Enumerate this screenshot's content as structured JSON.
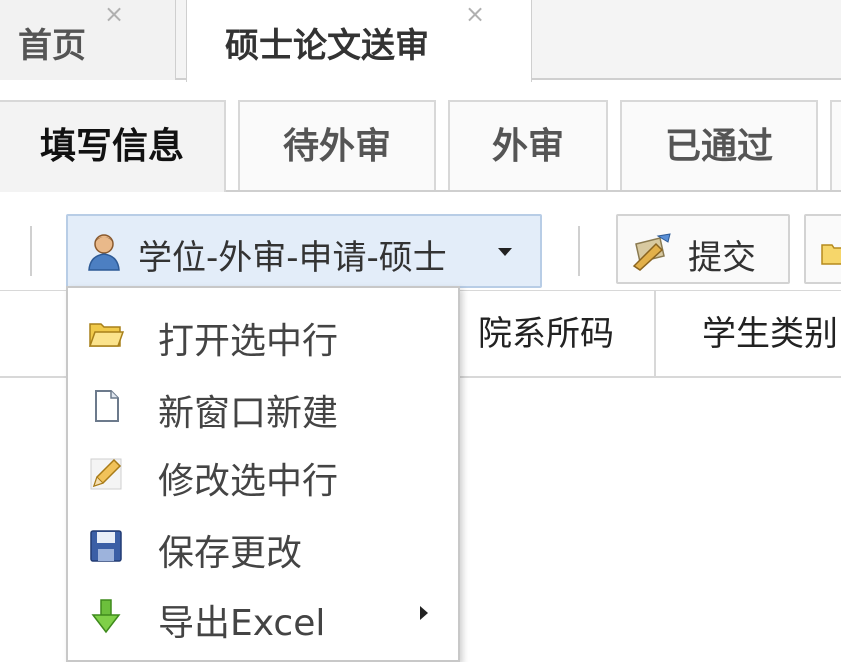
{
  "top_tabs": [
    {
      "label": "首页",
      "close": "×"
    },
    {
      "label": "硕士论文送审",
      "close": "×"
    }
  ],
  "sub_tabs": [
    "填写信息",
    "待外审",
    "外审",
    "已通过"
  ],
  "toolbar": {
    "menu_button_label": "学位-外审-申请-硕士",
    "menu_button_icon": "user-icon",
    "submit_label": "提交",
    "submit_icon": "pen-icon",
    "extra_icon": "folder-icon"
  },
  "grid": {
    "columns": [
      "院系所码",
      "学生类别"
    ]
  },
  "menu": {
    "items": [
      {
        "label": "打开选中行",
        "icon": "folder-open-icon"
      },
      {
        "label": "新窗口新建",
        "icon": "new-document-icon"
      },
      {
        "label": "修改选中行",
        "icon": "pencil-icon"
      },
      {
        "label": "保存更改",
        "icon": "save-icon"
      },
      {
        "label": "导出Excel",
        "icon": "export-down-arrow-icon"
      }
    ]
  },
  "colors": {
    "menu_button_bg": "#e3edf9",
    "menu_button_border": "#b8cde6",
    "tab_border": "#cfcfcf",
    "menu_border": "#c8c8c8"
  }
}
